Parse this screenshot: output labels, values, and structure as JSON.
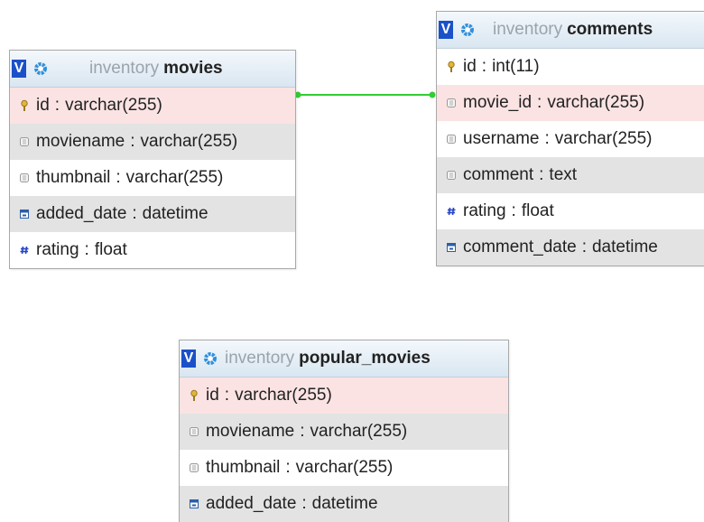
{
  "tables": [
    {
      "key": "movies",
      "db": "inventory",
      "name": "movies",
      "toggle": "V",
      "columns": [
        {
          "name": "id",
          "type": "varchar(255)",
          "icon": "key-icon",
          "pk": true
        },
        {
          "name": "moviename",
          "type": "varchar(255)",
          "icon": "column-icon"
        },
        {
          "name": "thumbnail",
          "type": "varchar(255)",
          "icon": "column-icon"
        },
        {
          "name": "added_date",
          "type": "datetime",
          "icon": "date-icon"
        },
        {
          "name": "rating",
          "type": "float",
          "icon": "number-icon"
        }
      ]
    },
    {
      "key": "comments",
      "db": "inventory",
      "name": "comments",
      "toggle": "V",
      "columns": [
        {
          "name": "id",
          "type": "int(11)",
          "icon": "key-icon"
        },
        {
          "name": "movie_id",
          "type": "varchar(255)",
          "icon": "column-icon",
          "pk": true
        },
        {
          "name": "username",
          "type": "varchar(255)",
          "icon": "column-icon"
        },
        {
          "name": "comment",
          "type": "text",
          "icon": "column-icon"
        },
        {
          "name": "rating",
          "type": "float",
          "icon": "number-icon"
        },
        {
          "name": "comment_date",
          "type": "datetime",
          "icon": "date-icon"
        }
      ]
    },
    {
      "key": "popular_movies",
      "db": "inventory",
      "name": "popular_movies",
      "toggle": "V",
      "columns": [
        {
          "name": "id",
          "type": "varchar(255)",
          "icon": "key-icon",
          "pk": true
        },
        {
          "name": "moviename",
          "type": "varchar(255)",
          "icon": "column-icon"
        },
        {
          "name": "thumbnail",
          "type": "varchar(255)",
          "icon": "column-icon"
        },
        {
          "name": "added_date",
          "type": "datetime",
          "icon": "date-icon"
        }
      ]
    }
  ],
  "relations": [
    {
      "from_table": "movies",
      "from_column": "id",
      "to_table": "comments",
      "to_column": "movie_id",
      "color": "#33cc33"
    }
  ],
  "colors": {
    "header_toggle": "#1a51c9",
    "gear": "#2f8fdc",
    "pk_row": "#fbe3e3",
    "alt_row": "#e3e3e3",
    "relation": "#33cc33"
  }
}
